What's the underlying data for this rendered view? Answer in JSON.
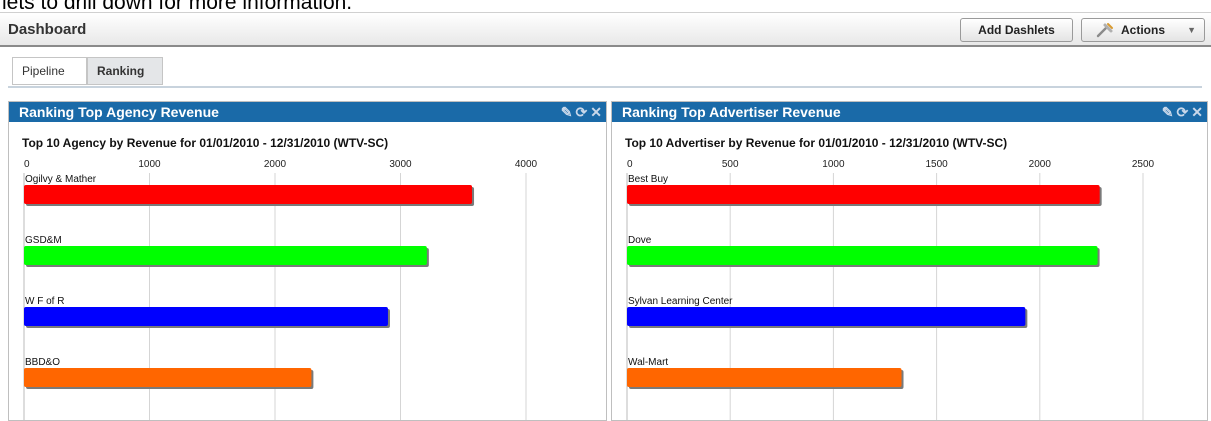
{
  "page_caption": "lets to drill down for more information.",
  "header": {
    "title": "Dashboard",
    "add_dashlets": "Add Dashlets",
    "actions": "Actions"
  },
  "tabs": [
    {
      "label": "Pipeline"
    },
    {
      "label": "Ranking"
    }
  ],
  "dashlets": [
    {
      "title": "Ranking Top Agency Revenue"
    },
    {
      "title": "Ranking Top Advertiser Revenue"
    }
  ],
  "chart_data": [
    {
      "type": "bar",
      "orientation": "horizontal",
      "title": "Top 10 Agency by Revenue  for 01/01/2010 - 12/31/2010 (WTV-SC)",
      "xlim": [
        0,
        4000
      ],
      "ticks": [
        0,
        1000,
        2000,
        3000,
        4000
      ],
      "categories": [
        "Ogilvy & Mather",
        "GSD&M",
        "W F of R",
        "BBD&O"
      ],
      "values": [
        3570,
        3210,
        2900,
        2290
      ],
      "colors": [
        "#ff0000",
        "#00ff00",
        "#0000ff",
        "#ff6600"
      ],
      "grid": true
    },
    {
      "type": "bar",
      "orientation": "horizontal",
      "title": "Top 10 Advertiser by Revenue  for 01/01/2010 - 12/31/2010 (WTV-SC)",
      "xlim": [
        0,
        2500
      ],
      "ticks": [
        0,
        500,
        1000,
        1500,
        2000,
        2500
      ],
      "categories": [
        "Best Buy",
        "Dove",
        "Sylvan Learning Center",
        "Wal-Mart"
      ],
      "values": [
        2290,
        2280,
        1930,
        1330
      ],
      "colors": [
        "#ff0000",
        "#00ff00",
        "#0000ff",
        "#ff6600"
      ],
      "grid": true
    }
  ]
}
